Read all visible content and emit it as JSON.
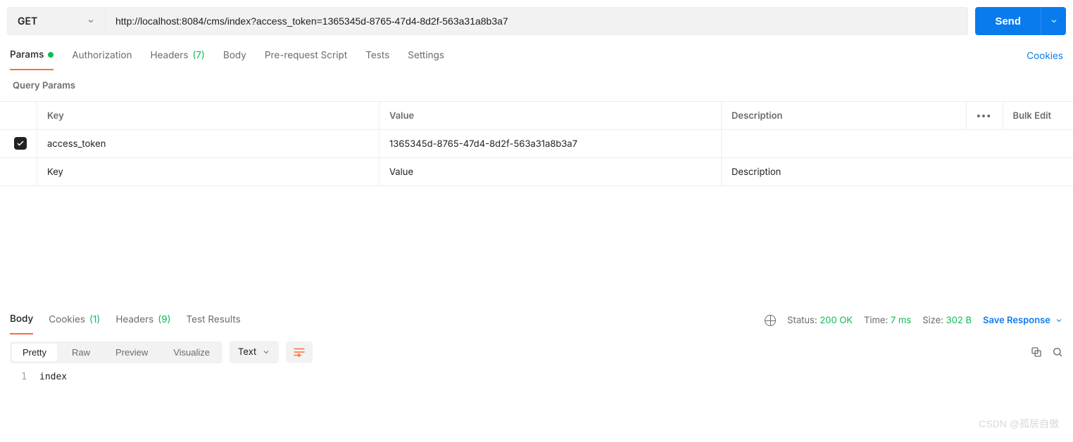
{
  "request": {
    "method": "GET",
    "url": "http://localhost:8084/cms/index?access_token=1365345d-8765-47d4-8d2f-563a31a8b3a7",
    "send_label": "Send"
  },
  "tabs": {
    "items": [
      {
        "label": "Params",
        "active": true,
        "indicator": "dot"
      },
      {
        "label": "Authorization",
        "active": false
      },
      {
        "label": "Headers",
        "active": false,
        "count": "(7)"
      },
      {
        "label": "Body",
        "active": false
      },
      {
        "label": "Pre-request Script",
        "active": false
      },
      {
        "label": "Tests",
        "active": false
      },
      {
        "label": "Settings",
        "active": false
      }
    ],
    "cookies_label": "Cookies"
  },
  "query_params": {
    "heading": "Query Params",
    "columns": {
      "key": "Key",
      "value": "Value",
      "description": "Description"
    },
    "bulk_label": "Bulk Edit",
    "rows": [
      {
        "checked": true,
        "key": "access_token",
        "value": "1365345d-8765-47d4-8d2f-563a31a8b3a7",
        "description": ""
      }
    ],
    "placeholders": {
      "key": "Key",
      "value": "Value",
      "description": "Description"
    }
  },
  "response": {
    "tabs": [
      {
        "label": "Body",
        "active": true
      },
      {
        "label": "Cookies",
        "count": "(1)"
      },
      {
        "label": "Headers",
        "count": "(9)"
      },
      {
        "label": "Test Results"
      }
    ],
    "status": {
      "label": "Status:",
      "value": "200 OK"
    },
    "time": {
      "label": "Time:",
      "value": "7 ms"
    },
    "size": {
      "label": "Size:",
      "value": "302 B"
    },
    "save_label": "Save Response",
    "view": {
      "modes": [
        {
          "label": "Pretty",
          "active": true
        },
        {
          "label": "Raw"
        },
        {
          "label": "Preview"
        },
        {
          "label": "Visualize"
        }
      ],
      "format": "Text"
    },
    "body_lines": [
      {
        "n": "1",
        "text": "index"
      }
    ]
  },
  "watermark": "CSDN @孤居自傲"
}
